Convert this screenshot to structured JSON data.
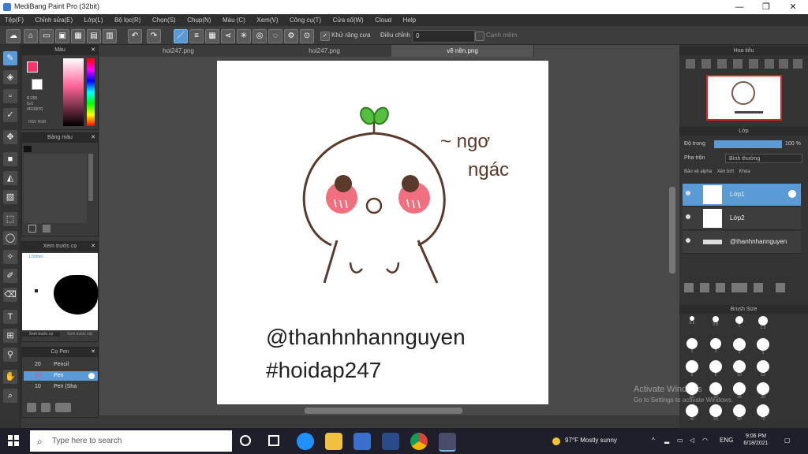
{
  "window": {
    "title": "MediBang Paint Pro (32bit)",
    "minimize": "—",
    "maximize": "❐",
    "close": "✕"
  },
  "menu": [
    "Tệp(F)",
    "Chỉnh sửa(E)",
    "Lớp(L)",
    "Bộ lọc(R)",
    "Chọn(S)",
    "Chụp(N)",
    "Màu (C)",
    "Xem(V)",
    "Công cụ(T)",
    "Cửa sổ(W)",
    "Cloud",
    "Help"
  ],
  "toolbar": {
    "checkbox_label": "Khử răng cưa",
    "select_label": "Điều chỉnh",
    "select_value": "0",
    "disabled_label": "Cạnh mềm",
    "undo_icon": "↶",
    "redo_icon": "↷"
  },
  "color_panel": {
    "title": "Màu",
    "rgb_line1": "R:255",
    "rgb_line2": "G:0",
    "rgb_line3": "#FF0070",
    "hsv_label": "HSV",
    "rgb_label": "RGB"
  },
  "palette_panel": {
    "title": "Bảng màu"
  },
  "navigator_panel": {
    "title": "Xem trước cọ",
    "value": "1.60mm",
    "tab1": "Xem trước cọ",
    "tab2": "Xem trước vật"
  },
  "brush_panel": {
    "title": "Cọ Pen",
    "items": [
      {
        "size": "20",
        "name": "Pencil",
        "selected": false
      },
      {
        "size": "15",
        "name": "Pen",
        "selected": true
      },
      {
        "size": "10",
        "name": "Pen (Sha",
        "selected": false
      }
    ]
  },
  "canvas_tabs": [
    "hoi247.png",
    "hoi247.png",
    "vẽ nền.png"
  ],
  "artwork": {
    "text_1": "~ ngơ",
    "text_2": "ngác",
    "caption_1": "@thanhnhannguyen",
    "caption_2": "#hoidap247"
  },
  "right": {
    "navigator_title": "Hoa tiêu",
    "layers_title": "Lớp",
    "opacity_label": "Độ trong",
    "opacity_value": "100 %",
    "opacity_fraction": 1.0,
    "blend_label": "Pha trộn",
    "blend_value": "Bình thường",
    "opt1": "Bảo vệ alpha",
    "opt2": "Xén bớt",
    "opt3": "Khóa",
    "layers": [
      {
        "name": "Lớp1",
        "selected": true
      },
      {
        "name": "Lớp2",
        "selected": false
      },
      {
        "name": "@thanhnhannguyen",
        "selected": false
      }
    ],
    "brush_size_title": "Brush Size",
    "brush_sizes": [
      "0.6",
      "0.8",
      "1",
      "1.5",
      "2",
      "3",
      "4",
      "5",
      "6",
      "8",
      "10",
      "12",
      "15",
      "20",
      "25",
      "30",
      "40",
      "50",
      "60",
      "70"
    ]
  },
  "watermark": {
    "line1": "Activate Windows",
    "line2": "Go to Settings to activate Windows."
  },
  "taskbar": {
    "search_placeholder": "Type here to search",
    "weather": "97°F Mostly sunny",
    "time": "9:06 PM",
    "date": "6/18/2021",
    "lang": "ENG"
  },
  "colors": {
    "accent": "#5b9bd5",
    "primary_color": "#ff3366",
    "brown_line": "#5a3a2a",
    "blush": "#f07080",
    "leaf": "#55c040"
  }
}
